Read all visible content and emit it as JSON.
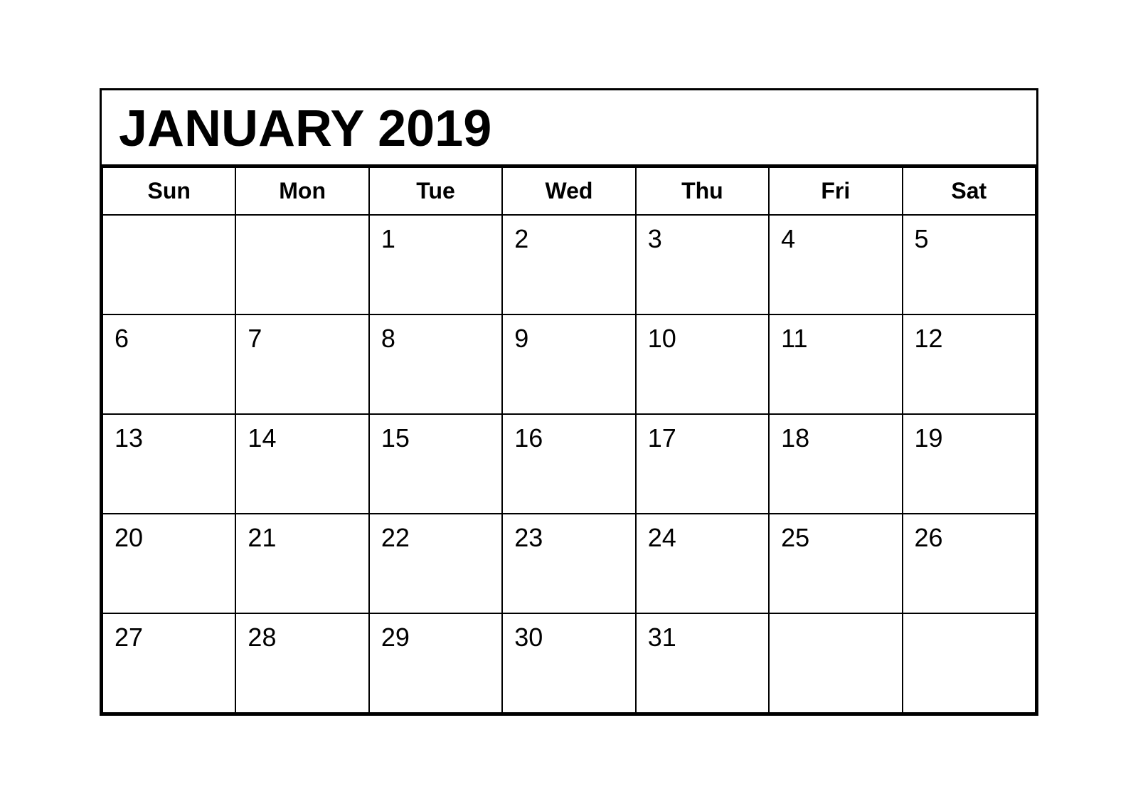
{
  "calendar": {
    "title": "JANUARY 2019",
    "days_of_week": [
      "Sun",
      "Mon",
      "Tue",
      "Wed",
      "Thu",
      "Fri",
      "Sat"
    ],
    "weeks": [
      [
        "",
        "",
        "1",
        "2",
        "3",
        "4",
        "5"
      ],
      [
        "6",
        "7",
        "8",
        "9",
        "10",
        "11",
        "12"
      ],
      [
        "13",
        "14",
        "15",
        "16",
        "17",
        "18",
        "19"
      ],
      [
        "20",
        "21",
        "22",
        "23",
        "24",
        "25",
        "26"
      ],
      [
        "27",
        "28",
        "29",
        "30",
        "31",
        "",
        ""
      ]
    ]
  }
}
